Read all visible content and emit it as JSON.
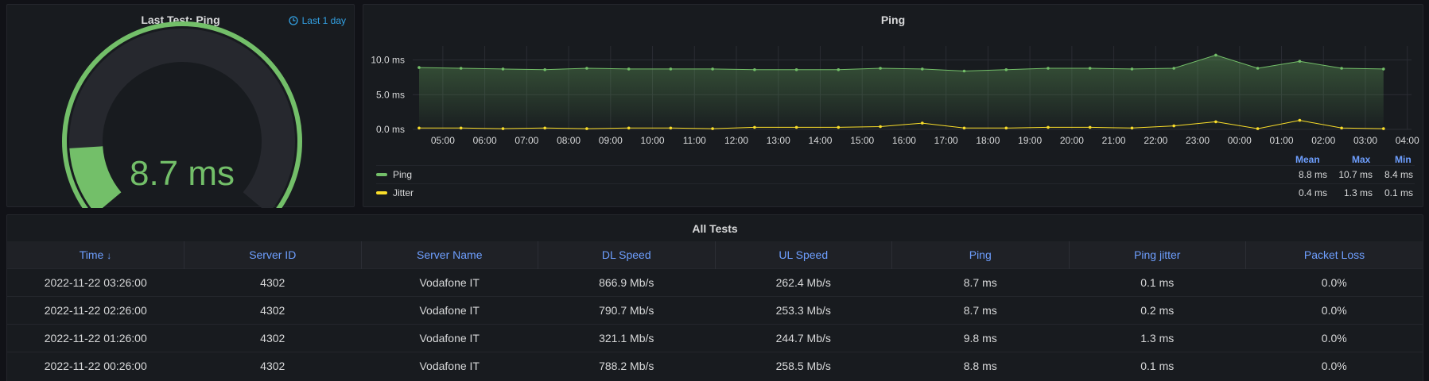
{
  "gauge": {
    "title": "Last Test: Ping",
    "time_range": "Last 1 day",
    "value_text": "8.7 ms",
    "value": 8.7,
    "threshold_fraction": 0.14,
    "colors": {
      "value": "#73bf69",
      "track": "#26282e",
      "threshold": "#73bf69"
    }
  },
  "ping_chart": {
    "title": "Ping",
    "legend": {
      "headers": {
        "mean": "Mean",
        "max": "Max",
        "min": "Min"
      },
      "rows": [
        {
          "name": "Ping",
          "color": "#73bf69",
          "mean": "8.8 ms",
          "max": "10.7 ms",
          "min": "8.4 ms"
        },
        {
          "name": "Jitter",
          "color": "#fade2a",
          "mean": "0.4 ms",
          "max": "1.3 ms",
          "min": "0.1 ms"
        }
      ]
    }
  },
  "chart_data": {
    "type": "line",
    "title": "Ping",
    "x": [
      "04:26",
      "05:26",
      "06:26",
      "07:26",
      "08:26",
      "09:26",
      "10:26",
      "11:26",
      "12:26",
      "13:26",
      "14:26",
      "15:26",
      "16:26",
      "17:26",
      "18:26",
      "19:26",
      "20:26",
      "21:26",
      "22:26",
      "23:26",
      "00:26",
      "01:26",
      "02:26",
      "03:26"
    ],
    "x_ticks": [
      "05:00",
      "06:00",
      "07:00",
      "08:00",
      "09:00",
      "10:00",
      "11:00",
      "12:00",
      "13:00",
      "14:00",
      "15:00",
      "16:00",
      "17:00",
      "18:00",
      "19:00",
      "20:00",
      "21:00",
      "22:00",
      "23:00",
      "00:00",
      "01:00",
      "02:00",
      "03:00",
      "04:00"
    ],
    "y_ticks": [
      "0.0 ms",
      "5.0 ms",
      "10.0 ms"
    ],
    "ylim": [
      0,
      12
    ],
    "grid": true,
    "legend_position": "bottom",
    "series": [
      {
        "name": "Ping",
        "color": "#73bf69",
        "fill": true,
        "values": [
          8.9,
          8.8,
          8.7,
          8.6,
          8.8,
          8.7,
          8.7,
          8.7,
          8.6,
          8.6,
          8.6,
          8.8,
          8.7,
          8.4,
          8.6,
          8.8,
          8.8,
          8.7,
          8.8,
          10.7,
          8.8,
          9.8,
          8.8,
          8.7
        ]
      },
      {
        "name": "Jitter",
        "color": "#fade2a",
        "fill": false,
        "values": [
          0.2,
          0.2,
          0.1,
          0.2,
          0.1,
          0.2,
          0.2,
          0.1,
          0.3,
          0.3,
          0.3,
          0.4,
          0.9,
          0.2,
          0.2,
          0.3,
          0.3,
          0.2,
          0.5,
          1.1,
          0.1,
          1.3,
          0.2,
          0.1
        ]
      }
    ]
  },
  "table": {
    "title": "All Tests",
    "columns": [
      "Time",
      "Server ID",
      "Server Name",
      "DL Speed",
      "UL Speed",
      "Ping",
      "Ping jitter",
      "Packet Loss"
    ],
    "sort_indicator": "↓",
    "rows": [
      [
        "2022-11-22 03:26:00",
        "4302",
        "Vodafone IT",
        "866.9 Mb/s",
        "262.4 Mb/s",
        "8.7 ms",
        "0.1 ms",
        "0.0%"
      ],
      [
        "2022-11-22 02:26:00",
        "4302",
        "Vodafone IT",
        "790.7 Mb/s",
        "253.3 Mb/s",
        "8.7 ms",
        "0.2 ms",
        "0.0%"
      ],
      [
        "2022-11-22 01:26:00",
        "4302",
        "Vodafone IT",
        "321.1 Mb/s",
        "244.7 Mb/s",
        "9.8 ms",
        "1.3 ms",
        "0.0%"
      ],
      [
        "2022-11-22 00:26:00",
        "4302",
        "Vodafone IT",
        "788.2 Mb/s",
        "258.5 Mb/s",
        "8.8 ms",
        "0.1 ms",
        "0.0%"
      ]
    ]
  }
}
